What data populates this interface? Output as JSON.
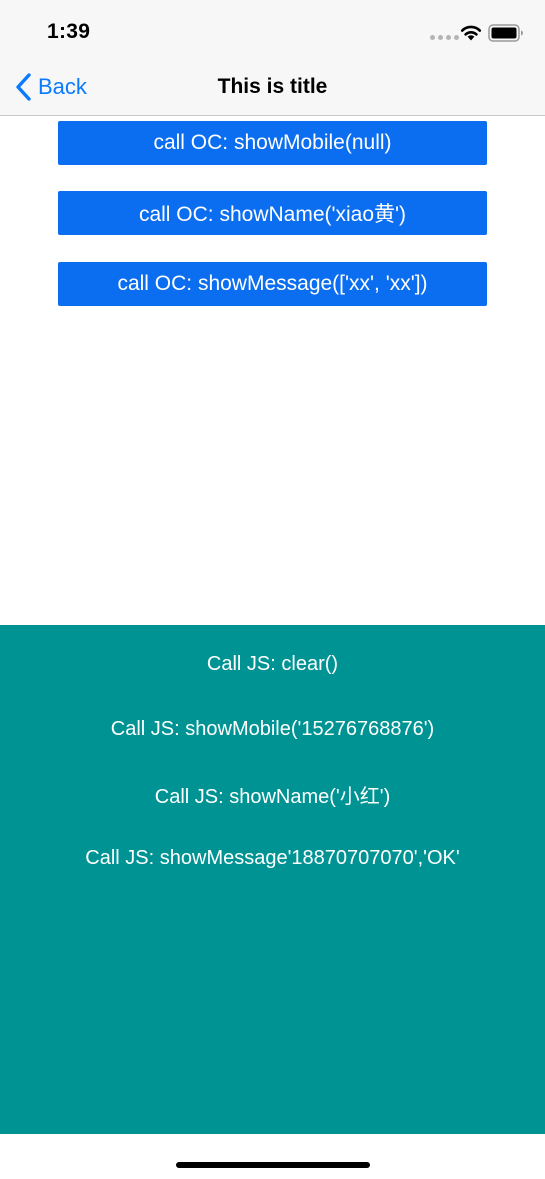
{
  "status_bar": {
    "time": "1:39",
    "icons": [
      "signal-icon",
      "wifi-icon",
      "battery-icon"
    ]
  },
  "nav": {
    "back_label": "Back",
    "title": "This is title",
    "accent_color": "#0a7afe"
  },
  "web_buttons": [
    {
      "label": "call OC: showMobile(null)"
    },
    {
      "label": "call OC: showName('xiao黄')"
    },
    {
      "label": "call OC: showMessage(['xx', 'xx'])"
    }
  ],
  "native_buttons": [
    {
      "label": "Call JS: clear()"
    },
    {
      "label": "Call JS: showMobile('15276768876')"
    },
    {
      "label": "Call JS: showName('小红')"
    },
    {
      "label": "Call JS: showMessage'18870707070','OK'"
    }
  ],
  "colors": {
    "web_button_bg": "#0b6ef0",
    "native_panel_bg": "#009393",
    "bar_bg": "#f7f7f7"
  }
}
